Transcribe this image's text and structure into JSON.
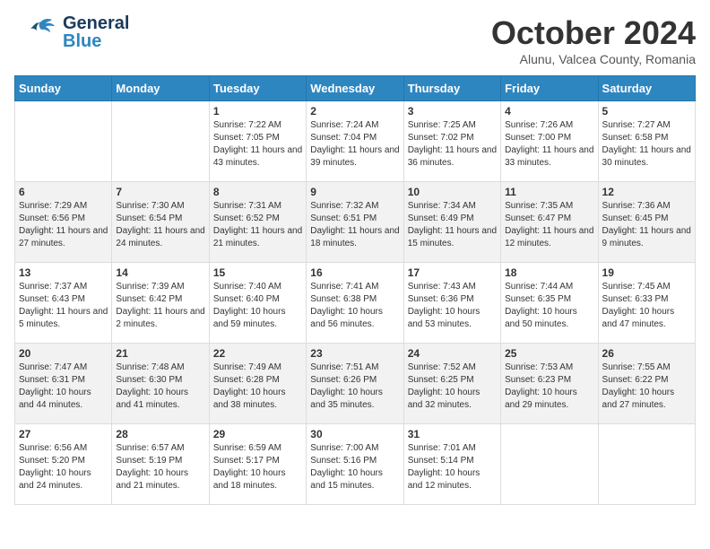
{
  "header": {
    "logo_general": "General",
    "logo_blue": "Blue",
    "month": "October 2024",
    "location": "Alunu, Valcea County, Romania"
  },
  "weekdays": [
    "Sunday",
    "Monday",
    "Tuesday",
    "Wednesday",
    "Thursday",
    "Friday",
    "Saturday"
  ],
  "weeks": [
    [
      {
        "day": "",
        "sunrise": "",
        "sunset": "",
        "daylight": ""
      },
      {
        "day": "",
        "sunrise": "",
        "sunset": "",
        "daylight": ""
      },
      {
        "day": "1",
        "sunrise": "Sunrise: 7:22 AM",
        "sunset": "Sunset: 7:05 PM",
        "daylight": "Daylight: 11 hours and 43 minutes."
      },
      {
        "day": "2",
        "sunrise": "Sunrise: 7:24 AM",
        "sunset": "Sunset: 7:04 PM",
        "daylight": "Daylight: 11 hours and 39 minutes."
      },
      {
        "day": "3",
        "sunrise": "Sunrise: 7:25 AM",
        "sunset": "Sunset: 7:02 PM",
        "daylight": "Daylight: 11 hours and 36 minutes."
      },
      {
        "day": "4",
        "sunrise": "Sunrise: 7:26 AM",
        "sunset": "Sunset: 7:00 PM",
        "daylight": "Daylight: 11 hours and 33 minutes."
      },
      {
        "day": "5",
        "sunrise": "Sunrise: 7:27 AM",
        "sunset": "Sunset: 6:58 PM",
        "daylight": "Daylight: 11 hours and 30 minutes."
      }
    ],
    [
      {
        "day": "6",
        "sunrise": "Sunrise: 7:29 AM",
        "sunset": "Sunset: 6:56 PM",
        "daylight": "Daylight: 11 hours and 27 minutes."
      },
      {
        "day": "7",
        "sunrise": "Sunrise: 7:30 AM",
        "sunset": "Sunset: 6:54 PM",
        "daylight": "Daylight: 11 hours and 24 minutes."
      },
      {
        "day": "8",
        "sunrise": "Sunrise: 7:31 AM",
        "sunset": "Sunset: 6:52 PM",
        "daylight": "Daylight: 11 hours and 21 minutes."
      },
      {
        "day": "9",
        "sunrise": "Sunrise: 7:32 AM",
        "sunset": "Sunset: 6:51 PM",
        "daylight": "Daylight: 11 hours and 18 minutes."
      },
      {
        "day": "10",
        "sunrise": "Sunrise: 7:34 AM",
        "sunset": "Sunset: 6:49 PM",
        "daylight": "Daylight: 11 hours and 15 minutes."
      },
      {
        "day": "11",
        "sunrise": "Sunrise: 7:35 AM",
        "sunset": "Sunset: 6:47 PM",
        "daylight": "Daylight: 11 hours and 12 minutes."
      },
      {
        "day": "12",
        "sunrise": "Sunrise: 7:36 AM",
        "sunset": "Sunset: 6:45 PM",
        "daylight": "Daylight: 11 hours and 9 minutes."
      }
    ],
    [
      {
        "day": "13",
        "sunrise": "Sunrise: 7:37 AM",
        "sunset": "Sunset: 6:43 PM",
        "daylight": "Daylight: 11 hours and 5 minutes."
      },
      {
        "day": "14",
        "sunrise": "Sunrise: 7:39 AM",
        "sunset": "Sunset: 6:42 PM",
        "daylight": "Daylight: 11 hours and 2 minutes."
      },
      {
        "day": "15",
        "sunrise": "Sunrise: 7:40 AM",
        "sunset": "Sunset: 6:40 PM",
        "daylight": "Daylight: 10 hours and 59 minutes."
      },
      {
        "day": "16",
        "sunrise": "Sunrise: 7:41 AM",
        "sunset": "Sunset: 6:38 PM",
        "daylight": "Daylight: 10 hours and 56 minutes."
      },
      {
        "day": "17",
        "sunrise": "Sunrise: 7:43 AM",
        "sunset": "Sunset: 6:36 PM",
        "daylight": "Daylight: 10 hours and 53 minutes."
      },
      {
        "day": "18",
        "sunrise": "Sunrise: 7:44 AM",
        "sunset": "Sunset: 6:35 PM",
        "daylight": "Daylight: 10 hours and 50 minutes."
      },
      {
        "day": "19",
        "sunrise": "Sunrise: 7:45 AM",
        "sunset": "Sunset: 6:33 PM",
        "daylight": "Daylight: 10 hours and 47 minutes."
      }
    ],
    [
      {
        "day": "20",
        "sunrise": "Sunrise: 7:47 AM",
        "sunset": "Sunset: 6:31 PM",
        "daylight": "Daylight: 10 hours and 44 minutes."
      },
      {
        "day": "21",
        "sunrise": "Sunrise: 7:48 AM",
        "sunset": "Sunset: 6:30 PM",
        "daylight": "Daylight: 10 hours and 41 minutes."
      },
      {
        "day": "22",
        "sunrise": "Sunrise: 7:49 AM",
        "sunset": "Sunset: 6:28 PM",
        "daylight": "Daylight: 10 hours and 38 minutes."
      },
      {
        "day": "23",
        "sunrise": "Sunrise: 7:51 AM",
        "sunset": "Sunset: 6:26 PM",
        "daylight": "Daylight: 10 hours and 35 minutes."
      },
      {
        "day": "24",
        "sunrise": "Sunrise: 7:52 AM",
        "sunset": "Sunset: 6:25 PM",
        "daylight": "Daylight: 10 hours and 32 minutes."
      },
      {
        "day": "25",
        "sunrise": "Sunrise: 7:53 AM",
        "sunset": "Sunset: 6:23 PM",
        "daylight": "Daylight: 10 hours and 29 minutes."
      },
      {
        "day": "26",
        "sunrise": "Sunrise: 7:55 AM",
        "sunset": "Sunset: 6:22 PM",
        "daylight": "Daylight: 10 hours and 27 minutes."
      }
    ],
    [
      {
        "day": "27",
        "sunrise": "Sunrise: 6:56 AM",
        "sunset": "Sunset: 5:20 PM",
        "daylight": "Daylight: 10 hours and 24 minutes."
      },
      {
        "day": "28",
        "sunrise": "Sunrise: 6:57 AM",
        "sunset": "Sunset: 5:19 PM",
        "daylight": "Daylight: 10 hours and 21 minutes."
      },
      {
        "day": "29",
        "sunrise": "Sunrise: 6:59 AM",
        "sunset": "Sunset: 5:17 PM",
        "daylight": "Daylight: 10 hours and 18 minutes."
      },
      {
        "day": "30",
        "sunrise": "Sunrise: 7:00 AM",
        "sunset": "Sunset: 5:16 PM",
        "daylight": "Daylight: 10 hours and 15 minutes."
      },
      {
        "day": "31",
        "sunrise": "Sunrise: 7:01 AM",
        "sunset": "Sunset: 5:14 PM",
        "daylight": "Daylight: 10 hours and 12 minutes."
      },
      {
        "day": "",
        "sunrise": "",
        "sunset": "",
        "daylight": ""
      },
      {
        "day": "",
        "sunrise": "",
        "sunset": "",
        "daylight": ""
      }
    ]
  ]
}
